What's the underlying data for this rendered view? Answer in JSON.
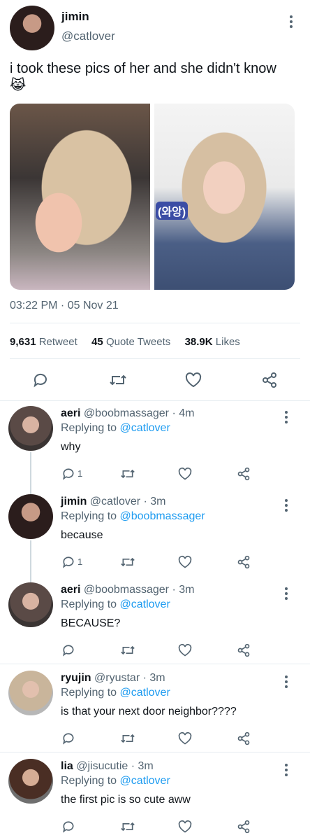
{
  "tweet": {
    "name": "jimin",
    "handle": "@catlover",
    "text": "i took these pics of her and she didn't know",
    "emoji": "😹",
    "photo2_caption": "(와앙)",
    "timestamp": "03:22 PM · 05 Nov 21",
    "stats": {
      "retweet_count": "9,631",
      "retweet_label": "Retweet",
      "quote_count": "45",
      "quote_label": "Quote Tweets",
      "like_count": "38.9K",
      "like_label": "Likes"
    }
  },
  "replies": [
    {
      "name": "aeri",
      "handle": "@boobmassager · 4m",
      "replying_label": "Replying to",
      "replying_to": "@catlover",
      "text": "why",
      "reply_count": "1"
    },
    {
      "name": "jimin",
      "handle": "@catlover · 3m",
      "replying_label": "Replying to",
      "replying_to": "@boobmassager",
      "text": "because",
      "reply_count": "1"
    },
    {
      "name": "aeri",
      "handle": "@boobmassager · 3m",
      "replying_label": "Replying to",
      "replying_to": "@catlover",
      "text": "BECAUSE?",
      "reply_count": ""
    },
    {
      "name": "ryujin",
      "handle": "@ryustar · 3m",
      "replying_label": "Replying to",
      "replying_to": "@catlover",
      "text": "is that your next door neighbor????",
      "reply_count": ""
    },
    {
      "name": "lia",
      "handle": "@jisucutie · 3m",
      "replying_label": "Replying to",
      "replying_to": "@catlover",
      "text": "the first pic is so cute aww",
      "reply_count": ""
    }
  ],
  "icons": {
    "reply": "speech-bubble-icon",
    "retweet": "retweet-icon",
    "like": "heart-icon",
    "share": "share-icon",
    "more": "kebab-icon"
  },
  "colors": {
    "link": "#1d9bf0",
    "secondary_text": "#536471",
    "divider": "#e6ecf0"
  }
}
